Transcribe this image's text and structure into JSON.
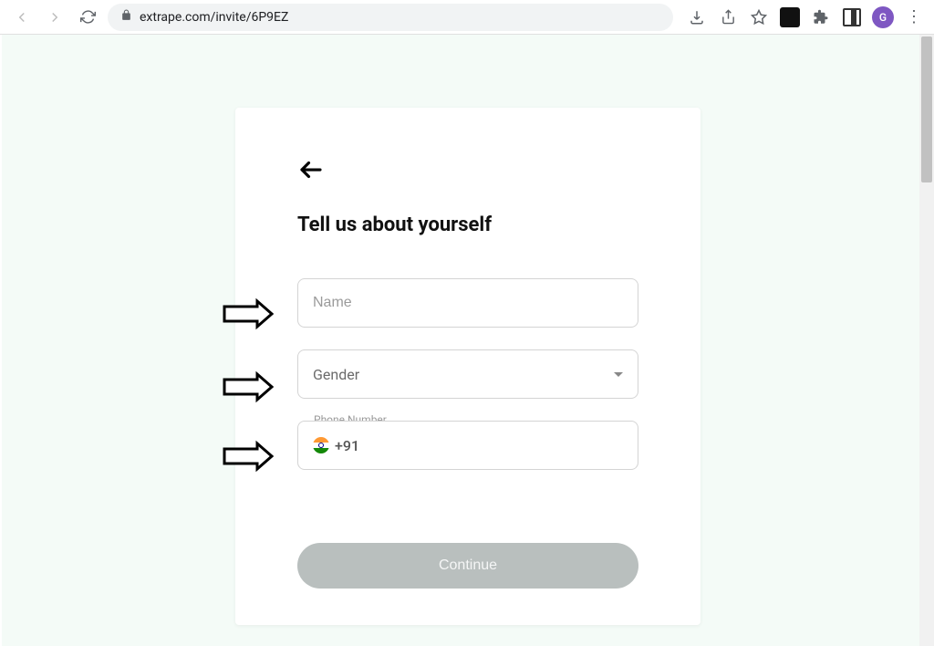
{
  "browser": {
    "url": "extrape.com/invite/6P9EZ",
    "avatar_initial": "G"
  },
  "form": {
    "title": "Tell us about yourself",
    "name_placeholder": "Name",
    "gender_label": "Gender",
    "phone_float_label": "Phone Number",
    "dialcode": "+91",
    "continue_label": "Continue"
  }
}
